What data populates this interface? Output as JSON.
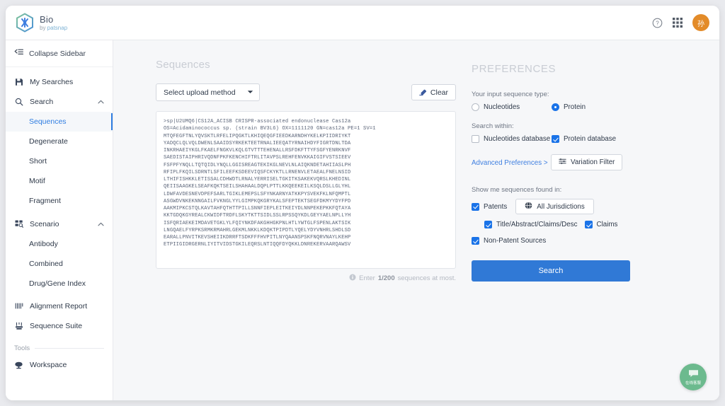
{
  "brand": {
    "title": "Bio",
    "by": "by ",
    "company": "patsnap"
  },
  "topbar": {
    "help_icon": "help-circle-icon",
    "apps_icon": "grid-apps-icon",
    "avatar_initial": "孙"
  },
  "sidebar": {
    "collapse_label": "Collapse Sidebar",
    "items": [
      {
        "label": "My Searches",
        "icon": "save-disk-icon"
      },
      {
        "label": "Search",
        "icon": "magnifier-icon",
        "expanded": true
      }
    ],
    "search_children": [
      {
        "label": "Sequences",
        "active": true
      },
      {
        "label": "Degenerate",
        "active": false
      },
      {
        "label": "Short",
        "active": false
      },
      {
        "label": "Motif",
        "active": false
      },
      {
        "label": "Fragment",
        "active": false
      }
    ],
    "scenario": {
      "label": "Scenario",
      "icon": "grid-search-icon"
    },
    "scenario_children": [
      {
        "label": "Antibody"
      },
      {
        "label": "Combined"
      },
      {
        "label": "Drug/Gene Index"
      }
    ],
    "alignment_report": {
      "label": "Alignment Report",
      "icon": "alignment-bars-icon"
    },
    "sequence_suite": {
      "label": "Sequence Suite",
      "icon": "suite-icon"
    },
    "tools_header": "Tools",
    "workspace": {
      "label": "Workspace",
      "icon": "workspace-icon"
    }
  },
  "main": {
    "page_title": "Sequences",
    "upload_method_label": "Select upload method",
    "clear_label": "Clear",
    "sequence_text": ">sp|U2UMQ6|CS12A_ACISB CRISPR-associated endonuclease Cas12a\nOS=Acidaminococcus sp. (strain BV3L6) OX=1111120 GN=cas12a PE=1 SV=1\nMTQFEGFTNLYQVSKTLRFELIPQGKTLKHIQEQGFIEEDKARNDHYKELKPIIDRIYKT\nYADQCLQLVQLDWENLSAAIDSYRKEKTEETRNALIEEQATYRNAIHDYFIGRTDNLTDA\nINKRHAEIYKGLFKAELFNGKVLKQLGTVTTTEHENALLRSFDKFTTYFSGFYENRKNVF\nSAEDISTAIPHRIVQDNFPKFKENCHIFTRLITAVPSLREHFENVKKAIGIFVSTSIEEV\nFSFPFYNQLLTQTQIDLYNQLLGGISREAGTEKIKGLNEVLNLAIQKNDETAHIIASLPH\nRFIPLFKQILSDRNTLSFILEEFKSDEEVIQSFCKYKTLLRNENVLETAEALFNELNSID\nLTHIFISHKKLETISSALCDHWDTLRNALYERRISELTGKITKSAKEKVQRSLKHEDINL\nQEIISAAGKELSEAFKQKTSEILSHAHAALDQPLPTTLKKQEEKEILKSQLDSLLGLYHL\nLDWFAVDESNEVDPEFSARLTGIKLEMEPSLSFYNKARNYATKKPYSVEKFKLNFQMPTL\nASGWDVNKEKNNGAILFVKNGLYYLGIMPKQKGRYKALSFEPTEKTSEGFDKMYYDYFPD\nAAKMIPKCSTQLKAVTAHFQTHTTPILLSNNFIEPLEITKEIYDLNNPEKEPKKFQTAYA\nKKTGDQKGYREALCKWIDFTRDFLSKYTKTTSIDLSSLRPSSQYKDLGEYYAELNPLLYH\nISFQRIAEKEIMDAVETGKLYLFQIYNKDFAKGHHGKPNLHTLYWTGLFSPENLAKTSIK\nLNGQAELFYRPKSRMKRMAHRLGEKMLNKKLKDQKTPIPDTLYQELYDYVNHRLSHDLSD\nEARALLPNVITKEVSHEIIKDRRFTSDKFFFHVPITLNYQAANSPSKFNQRVNAYLKEHP\nETPIIGIDRGERNLIYITVIDSTGKILEQRSLNTIQQFDYQKKLDNREKERVAARQAWSV",
    "footer_prefix": "Enter ",
    "footer_count": "1/200",
    "footer_suffix": " sequences at most.",
    "info_icon": "info-circle-icon"
  },
  "preferences": {
    "title": "PREFERENCES",
    "input_type_label": "Your input sequence type:",
    "input_types": [
      {
        "label": "Nucleotides",
        "selected": false
      },
      {
        "label": "Protein",
        "selected": true
      }
    ],
    "search_within_label": "Search within:",
    "databases": [
      {
        "label": "Nucleotides database",
        "checked": false
      },
      {
        "label": "Protein database",
        "checked": true
      }
    ],
    "advanced_link": "Advanced Preferences >",
    "variation_filter_label": "Variation Filter",
    "variation_filter_icon": "filter-lines-icon",
    "found_in_label": "Show me sequences found in:",
    "patents": {
      "label": "Patents",
      "checked": true
    },
    "jurisdictions": {
      "label": "All Jurisdictions",
      "icon": "globe-icon"
    },
    "patent_fields": [
      {
        "label": "Title/Abstract/Claims/Desc",
        "checked": true
      },
      {
        "label": "Claims",
        "checked": true
      }
    ],
    "non_patent": {
      "label": "Non-Patent Sources",
      "checked": true
    },
    "search_button": "Search",
    "accent_color": "#3079d6"
  },
  "chat_widget": {
    "label": "在线客服",
    "bubble_text": "在线",
    "color": "#6cba8e"
  }
}
